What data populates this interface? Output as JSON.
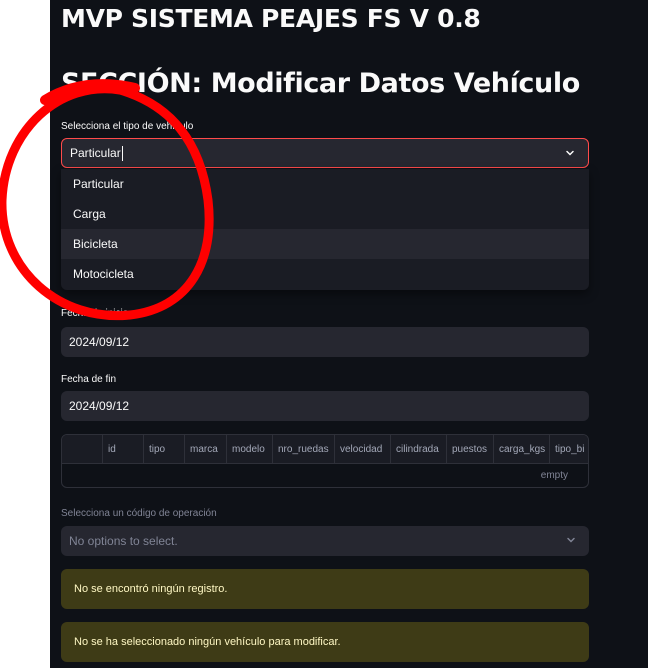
{
  "app": {
    "title": "MVP SISTEMA PEAJES FS V 0.8",
    "section": "SECCIÓN: Modificar Datos Vehículo"
  },
  "vehicle_type": {
    "label": "Selecciona el tipo de vehículo",
    "value": "Particular",
    "options": [
      "Particular",
      "Carga",
      "Bicicleta",
      "Motocicleta"
    ],
    "highlighted": "Bicicleta"
  },
  "start_date": {
    "label": "Fecha de inicio",
    "value": "2024/09/12"
  },
  "end_date": {
    "label": "Fecha de fin",
    "value": "2024/09/12"
  },
  "table": {
    "columns": [
      "id",
      "tipo",
      "marca",
      "modelo",
      "nro_ruedas",
      "velocidad",
      "cilindrada",
      "puestos",
      "carga_kgs",
      "tipo_bi"
    ],
    "empty_text": "empty"
  },
  "operation_code": {
    "label": "Selecciona un código de operación",
    "placeholder": "No options to select."
  },
  "alerts": [
    "No se encontró ningún registro.",
    "No se ha seleccionado ningún vehículo para modificar."
  ],
  "colors": {
    "background": "#0e1117",
    "input": "#262730",
    "accent": "#ff4b4b",
    "warning_bg": "#3e3b16",
    "warning_text": "#fff8c4",
    "annotation": "#ff0000"
  },
  "icons": {
    "select_chevron": "chevron-down-icon"
  }
}
